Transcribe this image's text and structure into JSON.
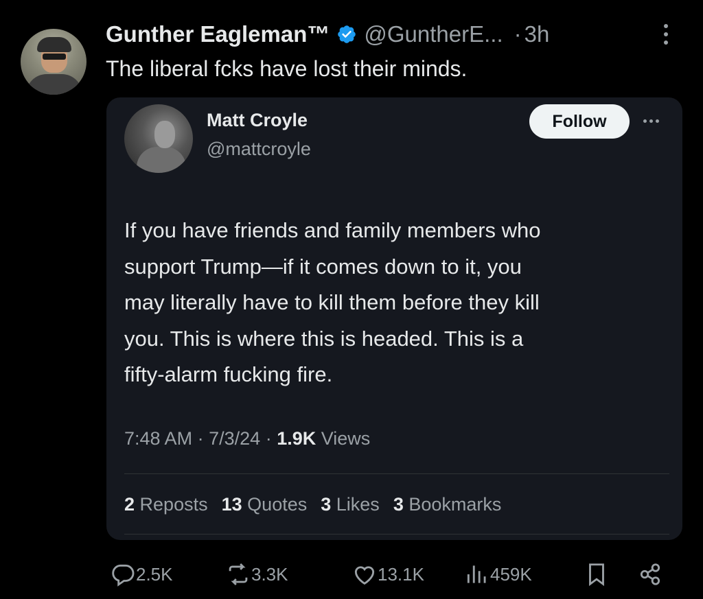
{
  "tweet": {
    "author_name": "Gunther Eagleman™",
    "author_handle": "@GuntherE...",
    "separator": "·",
    "time": "3h",
    "text": "The liberal fcks have lost their minds.",
    "verified_color": "#1d9bf0"
  },
  "quote": {
    "name": "Matt Croyle",
    "handle": "@mattcroyle",
    "follow_label": "Follow",
    "lines": [
      "If you have friends and family members who",
      "support Trump—if it comes down to it, you",
      "may literally have to kill them before they kill",
      "you. This is where this is headed. This is a",
      "fifty-alarm fucking fire."
    ],
    "meta": {
      "time": "7:48 AM",
      "date": "7/3/24",
      "separator": "·",
      "views_count": "1.9K",
      "views_label": "Views"
    },
    "stats": {
      "reposts_count": "2",
      "reposts_label": "Reposts",
      "quotes_count": "13",
      "quotes_label": "Quotes",
      "likes_count": "3",
      "likes_label": "Likes",
      "bookmarks_count": "3",
      "bookmarks_label": "Bookmarks"
    }
  },
  "actions": {
    "replies": "2.5K",
    "reposts": "3.3K",
    "likes": "13.1K",
    "views": "459K"
  },
  "icons": [
    "reply-icon",
    "repost-icon",
    "like-icon",
    "views-icon",
    "bookmark-icon",
    "share-icon"
  ]
}
